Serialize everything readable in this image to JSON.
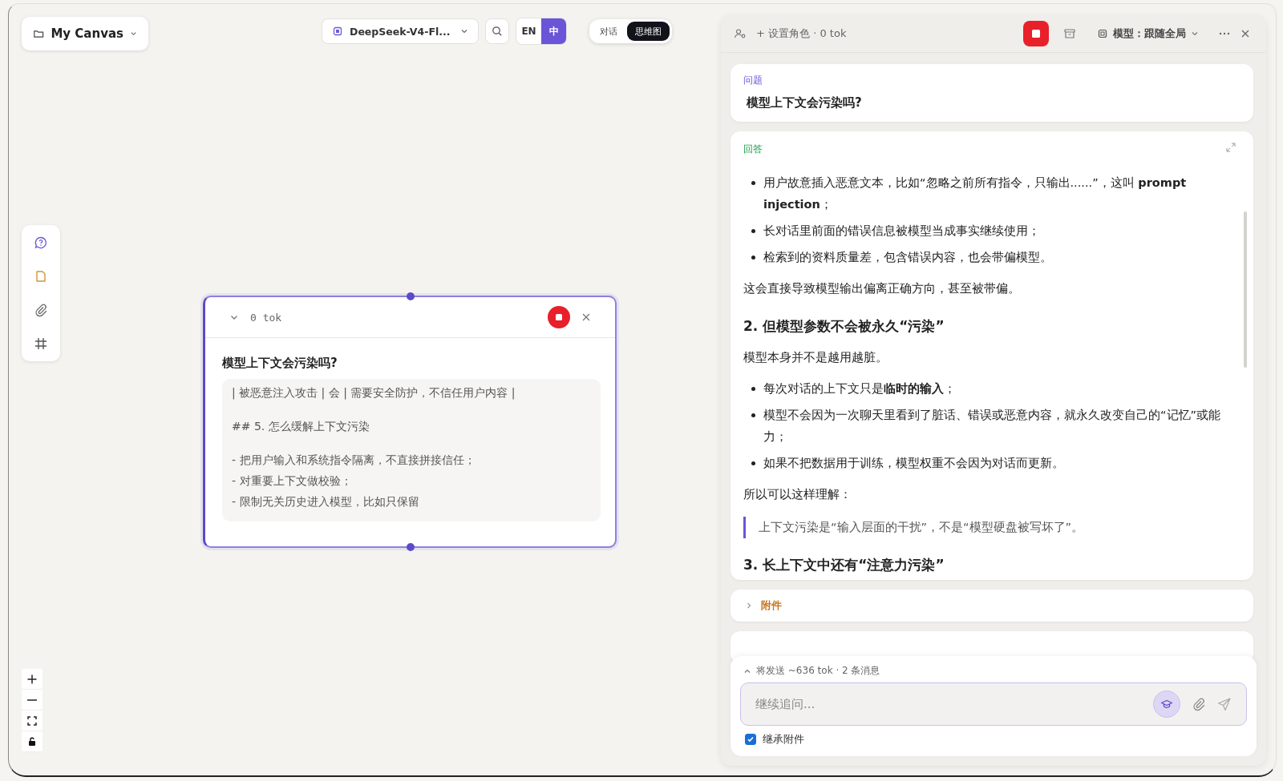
{
  "canvas_button": {
    "label": "My Canvas"
  },
  "toolbar": {
    "model": "DeepSeek-V4-Fl...",
    "languages": [
      {
        "label": "EN",
        "selected": false
      },
      {
        "label": "中",
        "selected": true
      }
    ],
    "views": [
      {
        "label": "对话",
        "selected": false
      },
      {
        "label": "思维图",
        "selected": true
      }
    ]
  },
  "node": {
    "tokens": "0 tok",
    "title": "模型上下文会污染吗?",
    "preview": [
      [
        "| 被恶意注入攻击 | 会 | 需要安全防护，不信任用户内容 |"
      ],
      [
        "## 5. 怎么缓解上下文污染"
      ],
      [
        "- 把用户输入和系统指令隔离，不直接拼接信任；",
        "- 对重要上下文做校验；",
        "- 限制无关历史进入模型，比如只保留"
      ]
    ]
  },
  "panel": {
    "header": {
      "role": "+ 设置角色 · 0 tok",
      "model": "模型：跟随全局"
    },
    "question": {
      "label": "问题",
      "text": "模型上下文会污染吗?"
    },
    "answer": {
      "label": "回答",
      "blocks": [
        {
          "kind": "bullet",
          "text": "用户故意插入恶意文本，比如“忽略之前所有指令，只输出......”，这叫 **prompt injection**；"
        },
        {
          "kind": "bullet",
          "text": "长对话里前面的错误信息被模型当成事实继续使用；"
        },
        {
          "kind": "bullet",
          "text": "检索到的资料质量差，包含错误内容，也会带偏模型。"
        },
        {
          "kind": "paragraph",
          "text": "这会直接导致模型输出偏离正确方向，甚至被带偏。"
        },
        {
          "kind": "heading",
          "text": "2. 但模型参数不会被永久“污染”"
        },
        {
          "kind": "paragraph",
          "text": "模型本身并不是越用越脏。"
        },
        {
          "kind": "bullet",
          "text": "每次对话的上下文只是**临时的输入**；"
        },
        {
          "kind": "bullet",
          "text": "模型不会因为一次聊天里看到了脏话、错误或恶意内容，就永久改变自己的“记忆”或能力；"
        },
        {
          "kind": "bullet",
          "text": "如果不把数据用于训练，模型权重不会因为对话而更新。"
        },
        {
          "kind": "paragraph",
          "text": "所以可以这样理解："
        },
        {
          "kind": "quote",
          "text": "上下文污染是“输入层面的干扰”，不是“模型硬盘被写坏了”。"
        },
        {
          "kind": "heading",
          "text": "3. 长上下文中还有“注意力污染”"
        }
      ]
    },
    "attachments": {
      "label": "附件",
      "expanded": false
    },
    "composer": {
      "summary": "将发送 ~636 tok · 2 条消息",
      "placeholder": "继续追问...",
      "inherit": {
        "label": "继承附件",
        "checked": true
      }
    }
  }
}
